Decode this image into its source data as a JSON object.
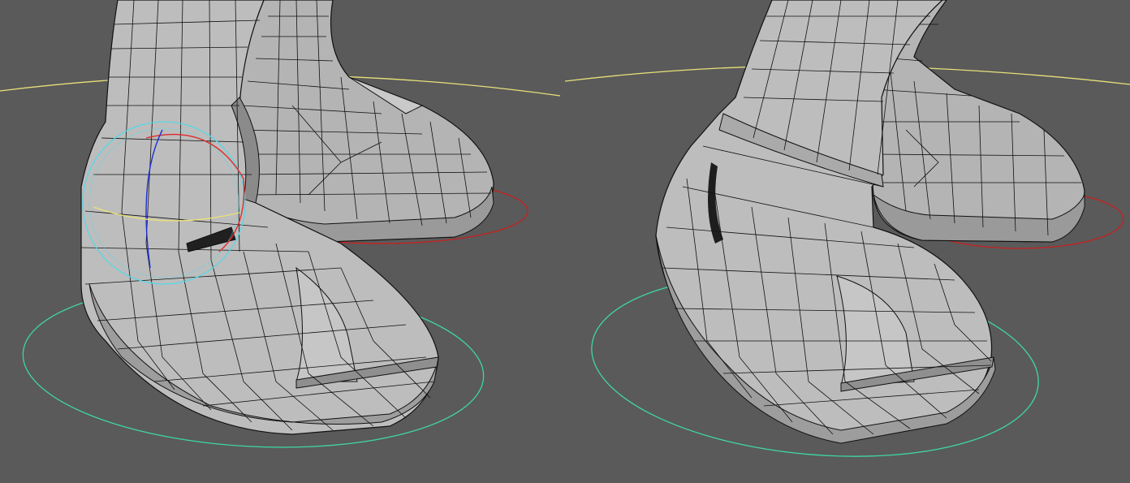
{
  "app": {
    "title": "",
    "colors": {
      "background": "#5a5a5a",
      "mesh_fill": "#b9b9b9",
      "mesh_shadow": "#8f8f8f",
      "mesh_highlight": "#d6d6d6",
      "wire": "#111111",
      "ik_control_yellow": "#e8e07a",
      "foot_control_cyan": "#3fd6a4",
      "foot_control_red": "#c82020",
      "rotate_gizmo_cyan": "#55d8e8",
      "rotate_gizmo_red": "#e02a2a",
      "rotate_gizmo_blue": "#2030d8",
      "rotate_gizmo_yellow": "#e8e07a"
    }
  },
  "viewports": [
    {
      "id": "left",
      "icons": [
        "rotate-manipulator-icon"
      ],
      "controls": [
        "yellow-ik-curve",
        "cyan-foot-control",
        "red-foot-control"
      ]
    },
    {
      "id": "right",
      "icons": [],
      "controls": [
        "yellow-ik-curve",
        "cyan-foot-control",
        "red-foot-control"
      ]
    }
  ]
}
